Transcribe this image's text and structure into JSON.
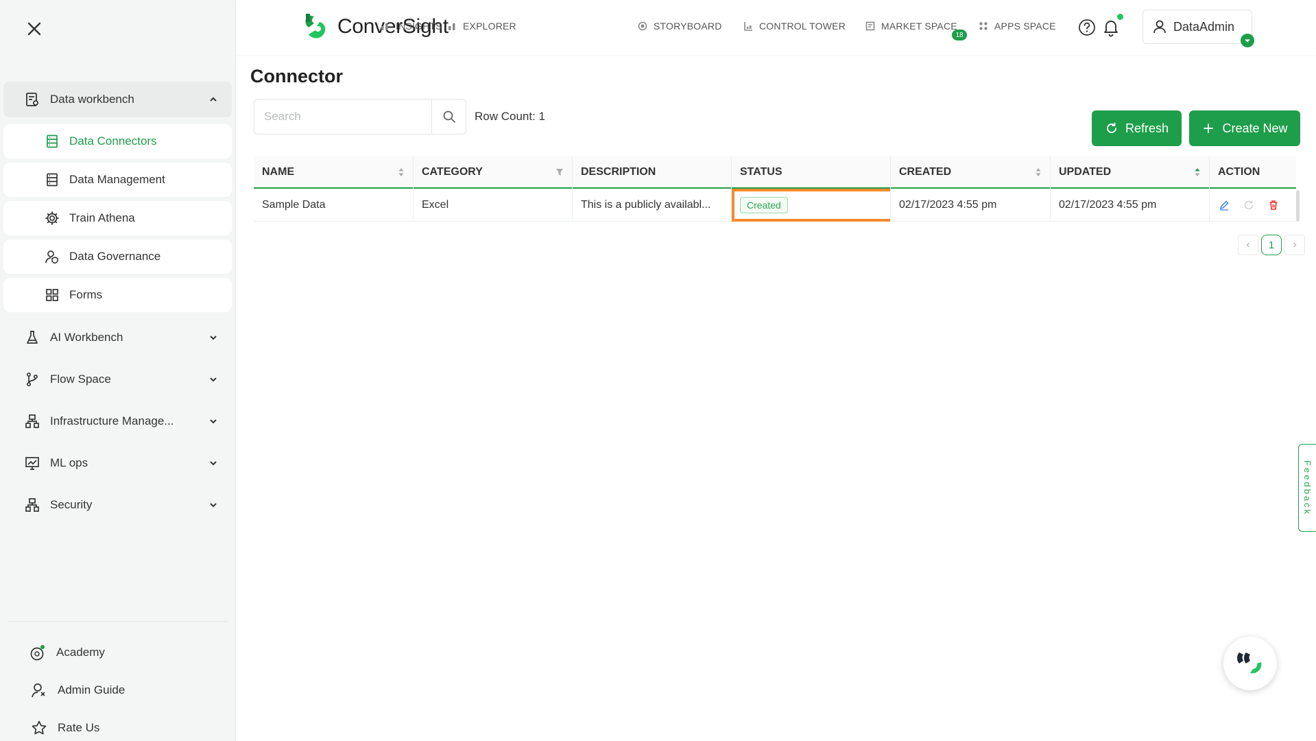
{
  "sidebar": {
    "groups": [
      {
        "label": "Data workbench",
        "icon": "data-workbench-icon",
        "expanded": true
      },
      {
        "label": "AI Workbench",
        "icon": "flask-icon"
      },
      {
        "label": "Flow Space",
        "icon": "flow-branch-icon"
      },
      {
        "label": "Infrastructure Manage...",
        "icon": "infrastructure-icon"
      },
      {
        "label": "ML ops",
        "icon": "mlops-icon"
      },
      {
        "label": "Security",
        "icon": "security-icon"
      }
    ],
    "children": [
      {
        "label": "Data Connectors",
        "icon": "database-icon",
        "active": true
      },
      {
        "label": "Data Management",
        "icon": "database-icon"
      },
      {
        "label": "Train Athena",
        "icon": "gear-icon"
      },
      {
        "label": "Data Governance",
        "icon": "user-shield-icon"
      },
      {
        "label": "Forms",
        "icon": "grid-icon"
      }
    ],
    "footer": [
      {
        "label": "Academy",
        "icon": "academy-icon"
      },
      {
        "label": "Admin Guide",
        "icon": "admin-guide-icon"
      },
      {
        "label": "Rate Us",
        "icon": "star-icon"
      }
    ]
  },
  "header": {
    "logo_text": "ConverSight",
    "nav": [
      {
        "label": "INSIGHTS",
        "icon": "bar-chart-icon"
      },
      {
        "label": "EXPLORER",
        "icon": "bar-chart-icon"
      },
      {
        "label": "STORYBOARD",
        "icon": "storyboard-icon",
        "badge": "18"
      },
      {
        "label": "CONTROL TOWER",
        "icon": "control-tower-icon"
      },
      {
        "label": "MARKET SPACE",
        "icon": "market-space-icon"
      },
      {
        "label": "APPS SPACE",
        "icon": "apps-grid-icon"
      }
    ],
    "user": "DataAdmin"
  },
  "main": {
    "title": "Connector",
    "search_placeholder": "Search",
    "row_count": "Row Count: 1",
    "refresh_label": "Refresh",
    "create_label": "Create New"
  },
  "table": {
    "columns": [
      "NAME",
      "CATEGORY",
      "DESCRIPTION",
      "STATUS",
      "CREATED",
      "UPDATED",
      "ACTION"
    ],
    "rows": [
      {
        "name": "Sample Data",
        "category": "Excel",
        "description": "This is a publicly availabl...",
        "status": "Created",
        "created": "02/17/2023 4:55 pm",
        "updated": "02/17/2023 4:55 pm"
      }
    ]
  },
  "pagination": {
    "current": "1"
  },
  "feedback_label": "Feedback",
  "colors": {
    "accent": "#1e9e4a",
    "highlight": "#f58b2d",
    "delete": "#e5322d",
    "edit": "#3b82f6"
  }
}
